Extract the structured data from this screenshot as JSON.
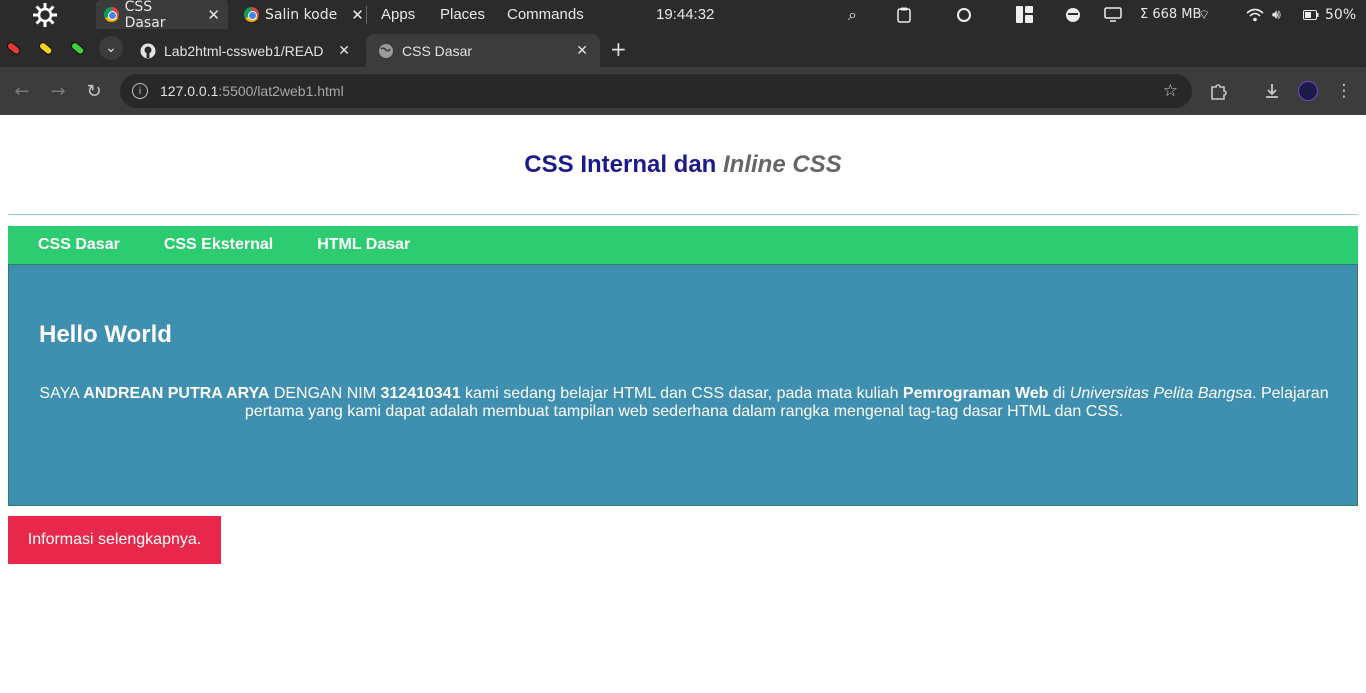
{
  "os_panel": {
    "tabs": [
      {
        "label": "CSS Dasar",
        "icon": "chrome-icon"
      },
      {
        "label": "Salin kode",
        "icon": "chrome-icon"
      }
    ],
    "menus": [
      "Apps",
      "Places",
      "Commands"
    ],
    "clock": "19:44:32",
    "memory": "Σ 668 MB",
    "battery": "50%"
  },
  "browser": {
    "tabs": [
      {
        "title": "Lab2html-cssweb1/READ",
        "icon": "github-icon",
        "active": false
      },
      {
        "title": "CSS Dasar",
        "icon": "globe-icon",
        "active": true
      }
    ],
    "url_host": "127.0.0.1",
    "url_path": ":5500/lat2web1.html"
  },
  "page": {
    "title_main": "CSS Internal dan ",
    "title_em": "Inline CSS",
    "nav": [
      "CSS Dasar",
      "CSS Eksternal",
      "HTML Dasar"
    ],
    "hero": {
      "heading": "Hello World",
      "p1": "SAYA ",
      "name": "ANDREAN PUTRA ARYA",
      "p2": " DENGAN NIM ",
      "nim": "312410341",
      "p3": " kami sedang belajar HTML dan CSS dasar, pada mata kuliah ",
      "course": "Pemrograman Web",
      "p4": " di ",
      "univ": "Universitas Pelita Bangsa",
      "p5": ". Pelajaran pertama yang kami dapat adalah membuat tampilan web sederhana dalam rangka mengenal tag-tag dasar HTML dan CSS."
    },
    "cta": "Informasi selengkapnya.",
    "colors": {
      "title": "#1a1a8c",
      "nav_bg": "#2ecc71",
      "hero_bg": "#3f8fb0",
      "cta_bg": "#e8284a"
    }
  }
}
